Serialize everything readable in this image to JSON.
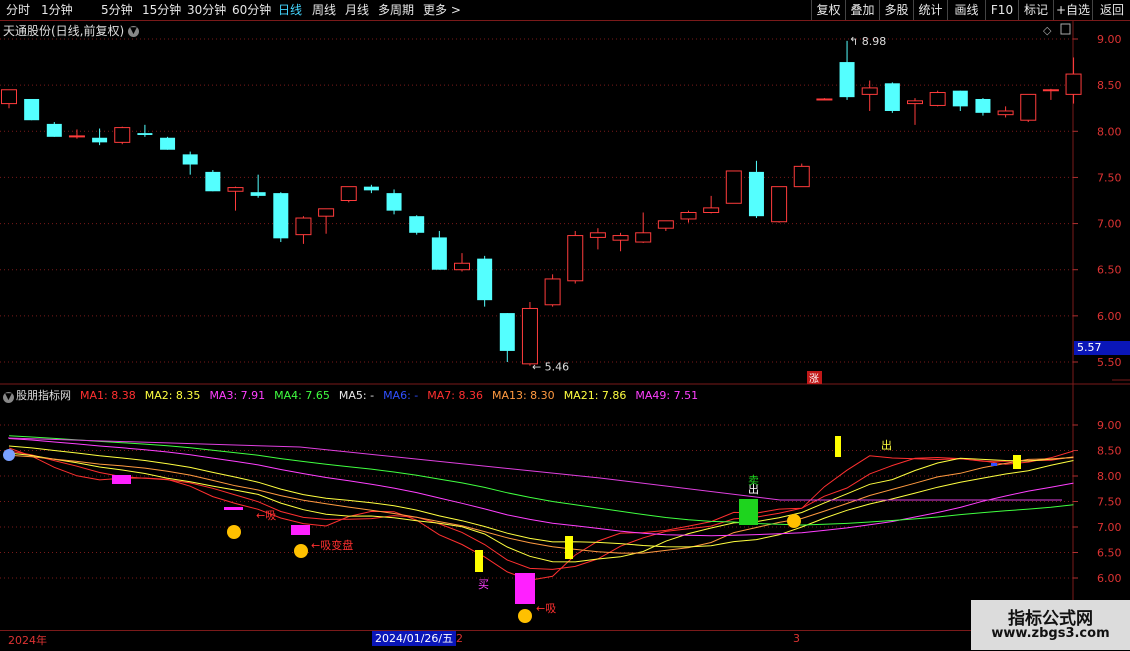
{
  "toolbar": {
    "periods": [
      "分时",
      "1分钟",
      "5分钟",
      "15分钟",
      "30分钟",
      "60分钟",
      "日线",
      "周线",
      "月线",
      "多周期",
      "更多 >"
    ],
    "active_period": "日线",
    "right_buttons": [
      "复权",
      "叠加",
      "多股",
      "统计",
      "画线",
      "F10",
      "标记",
      "+自选",
      "返回"
    ]
  },
  "main": {
    "title": "天通股份(日线,前复权)",
    "high_label": "8.98",
    "low_label": "5.46",
    "current_price": "5.57",
    "zhang_label": "涨",
    "axis_ticks": [
      "9.00",
      "8.50",
      "8.00",
      "7.50",
      "7.00",
      "6.50",
      "6.00",
      "5.50"
    ]
  },
  "indicator": {
    "name": "股朋指标网",
    "ma_items": [
      {
        "label": "MA1: 8.38",
        "color": "#ff3030"
      },
      {
        "label": "MA2: 8.35",
        "color": "#ffff40"
      },
      {
        "label": "MA3: 7.91",
        "color": "#ff40ff"
      },
      {
        "label": "MA4: 7.65",
        "color": "#40ff40"
      },
      {
        "label": "MA5: -",
        "color": "#e8e8e8"
      },
      {
        "label": "MA6: -",
        "color": "#3050ff"
      },
      {
        "label": "MA7: 8.36",
        "color": "#ff3030"
      },
      {
        "label": "MA13: 8.30",
        "color": "#ff9a40"
      },
      {
        "label": "MA21: 7.86",
        "color": "#ffff40"
      },
      {
        "label": "MA49: 7.51",
        "color": "#ff40ff"
      }
    ],
    "axis_ticks": [
      "9.00",
      "8.50",
      "8.00",
      "7.50",
      "7.00",
      "6.50",
      "6.00"
    ],
    "signals": {
      "xi1": "吸",
      "xibianpan": "吸变盘",
      "mai": "买",
      "xi2": "吸",
      "chu_green": "出",
      "mai_green": "卖",
      "chu_top": "出"
    }
  },
  "footer": {
    "year_label": "2024年",
    "cursor_date": "2024/01/26/五",
    "month_2": "2",
    "month_3": "3"
  },
  "watermark": {
    "line1": "指标公式网",
    "line2": "www.zbgs3.com"
  },
  "chart_data": {
    "type": "candlestick",
    "title": "天通股份(日线,前复权)",
    "ylim": [
      5.4,
      9.1
    ],
    "candles": [
      {
        "o": 8.3,
        "h": 8.45,
        "l": 8.25,
        "c": 8.45
      },
      {
        "o": 8.35,
        "h": 8.35,
        "l": 8.12,
        "c": 8.12
      },
      {
        "o": 8.08,
        "h": 8.1,
        "l": 7.94,
        "c": 7.94
      },
      {
        "o": 7.95,
        "h": 8.02,
        "l": 7.92,
        "c": 7.95
      },
      {
        "o": 7.93,
        "h": 8.03,
        "l": 7.85,
        "c": 7.88
      },
      {
        "o": 7.88,
        "h": 8.05,
        "l": 7.86,
        "c": 8.04
      },
      {
        "o": 7.98,
        "h": 8.07,
        "l": 7.94,
        "c": 7.96
      },
      {
        "o": 7.93,
        "h": 7.94,
        "l": 7.8,
        "c": 7.8
      },
      {
        "o": 7.75,
        "h": 7.78,
        "l": 7.53,
        "c": 7.64
      },
      {
        "o": 7.56,
        "h": 7.58,
        "l": 7.35,
        "c": 7.35
      },
      {
        "o": 7.35,
        "h": 7.4,
        "l": 7.14,
        "c": 7.39
      },
      {
        "o": 7.34,
        "h": 7.53,
        "l": 7.28,
        "c": 7.3
      },
      {
        "o": 7.33,
        "h": 7.34,
        "l": 6.8,
        "c": 6.84
      },
      {
        "o": 6.88,
        "h": 7.08,
        "l": 6.78,
        "c": 7.06
      },
      {
        "o": 7.08,
        "h": 7.16,
        "l": 6.89,
        "c": 7.16
      },
      {
        "o": 7.25,
        "h": 7.4,
        "l": 7.23,
        "c": 7.4
      },
      {
        "o": 7.4,
        "h": 7.42,
        "l": 7.33,
        "c": 7.36
      },
      {
        "o": 7.33,
        "h": 7.37,
        "l": 7.1,
        "c": 7.14
      },
      {
        "o": 7.08,
        "h": 7.09,
        "l": 6.88,
        "c": 6.9
      },
      {
        "o": 6.85,
        "h": 6.92,
        "l": 6.5,
        "c": 6.5
      },
      {
        "o": 6.5,
        "h": 6.68,
        "l": 6.48,
        "c": 6.57
      },
      {
        "o": 6.62,
        "h": 6.65,
        "l": 6.1,
        "c": 6.17
      },
      {
        "o": 6.03,
        "h": 6.03,
        "l": 5.5,
        "c": 5.62
      },
      {
        "o": 5.48,
        "h": 6.15,
        "l": 5.46,
        "c": 6.08
      },
      {
        "o": 6.12,
        "h": 6.45,
        "l": 6.1,
        "c": 6.4
      },
      {
        "o": 6.38,
        "h": 6.92,
        "l": 6.35,
        "c": 6.87
      },
      {
        "o": 6.85,
        "h": 6.95,
        "l": 6.72,
        "c": 6.9
      },
      {
        "o": 6.82,
        "h": 6.9,
        "l": 6.7,
        "c": 6.87
      },
      {
        "o": 6.8,
        "h": 7.12,
        "l": 6.79,
        "c": 6.9
      },
      {
        "o": 6.95,
        "h": 7.03,
        "l": 6.92,
        "c": 7.03
      },
      {
        "o": 7.05,
        "h": 7.14,
        "l": 7.01,
        "c": 7.12
      },
      {
        "o": 7.12,
        "h": 7.3,
        "l": 7.11,
        "c": 7.17
      },
      {
        "o": 7.22,
        "h": 7.57,
        "l": 7.22,
        "c": 7.57
      },
      {
        "o": 7.56,
        "h": 7.68,
        "l": 7.06,
        "c": 7.08
      },
      {
        "o": 7.02,
        "h": 7.4,
        "l": 7.01,
        "c": 7.4
      },
      {
        "o": 7.4,
        "h": 7.65,
        "l": 7.4,
        "c": 7.62
      },
      {
        "o": 8.35,
        "h": 8.36,
        "l": 8.34,
        "c": 8.35
      },
      {
        "o": 8.75,
        "h": 8.98,
        "l": 8.34,
        "c": 8.37
      },
      {
        "o": 8.4,
        "h": 8.55,
        "l": 8.22,
        "c": 8.47
      },
      {
        "o": 8.52,
        "h": 8.53,
        "l": 8.2,
        "c": 8.22
      },
      {
        "o": 8.3,
        "h": 8.36,
        "l": 8.07,
        "c": 8.33
      },
      {
        "o": 8.28,
        "h": 8.44,
        "l": 8.27,
        "c": 8.42
      },
      {
        "o": 8.44,
        "h": 8.44,
        "l": 8.22,
        "c": 8.27
      },
      {
        "o": 8.35,
        "h": 8.36,
        "l": 8.17,
        "c": 8.2
      },
      {
        "o": 8.18,
        "h": 8.27,
        "l": 8.15,
        "c": 8.22
      },
      {
        "o": 8.12,
        "h": 8.4,
        "l": 8.1,
        "c": 8.4
      },
      {
        "o": 8.45,
        "h": 8.46,
        "l": 8.34,
        "c": 8.45
      },
      {
        "o": 8.4,
        "h": 8.8,
        "l": 8.3,
        "c": 8.62
      }
    ]
  }
}
